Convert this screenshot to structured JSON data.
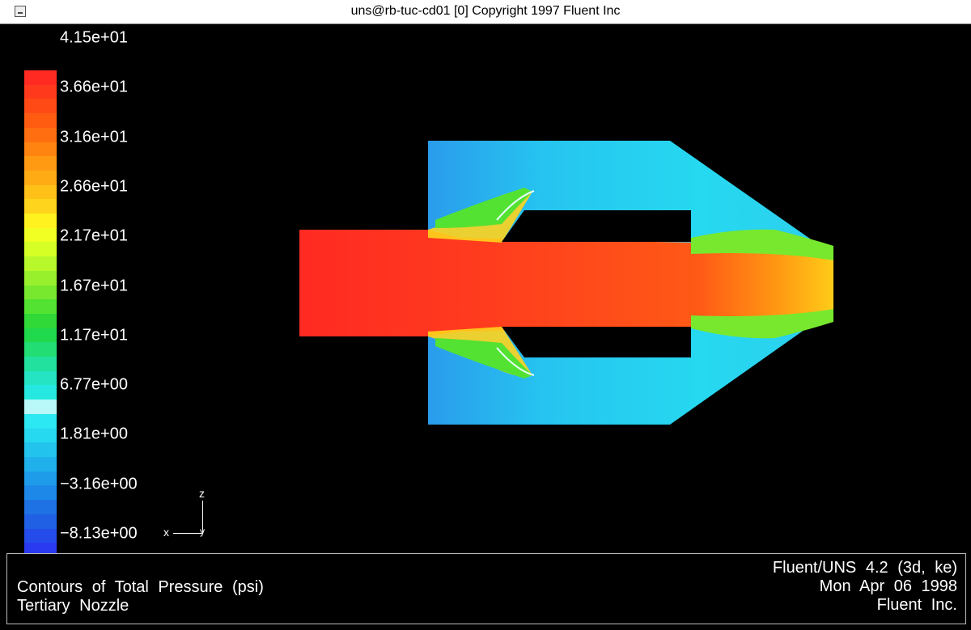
{
  "window": {
    "title": "uns@rb-tuc-cd01 [0]  Copyright 1997  Fluent Inc"
  },
  "legend": {
    "labels": [
      "4.15e+01",
      "3.66e+01",
      "3.16e+01",
      "2.66e+01",
      "2.17e+01",
      "1.67e+01",
      "1.17e+01",
      "6.77e+00",
      "1.81e+00",
      "−3.16e+00",
      "−8.13e+00"
    ],
    "colors": [
      "#ff2a22",
      "#ff3a1c",
      "#ff4a16",
      "#ff5c12",
      "#ff6e10",
      "#ff8410",
      "#ff9a12",
      "#ffac14",
      "#ffc018",
      "#ffd41c",
      "#fff21e",
      "#f2ff22",
      "#d6ff26",
      "#b8f82a",
      "#98f02c",
      "#78e82e",
      "#54e232",
      "#30d838",
      "#20d84c",
      "#22dc74",
      "#22e09e",
      "#24e4c4",
      "#26e8e0",
      "#b8f8f8",
      "#2ce8f2",
      "#26d8f0",
      "#22c4ee",
      "#20b0ec",
      "#1e9cea",
      "#1e88e8",
      "#1e72e4",
      "#2060e4",
      "#244cea",
      "#2a3af0",
      "#3028f4"
    ]
  },
  "axes": {
    "z": "z",
    "x": "x",
    "y": "y"
  },
  "info": {
    "left_line1": "Contours of Total Pressure (psi)",
    "left_line2": "Tertiary Nozzle",
    "right_line1": "Fluent/UNS 4.2 (3d, ke)",
    "right_line2": "Mon Apr 06 1998",
    "right_line3": "Fluent Inc."
  },
  "colors": {
    "titlebar": "#ffffff",
    "background": "#000000",
    "panel_border": "#bbbbbb"
  }
}
